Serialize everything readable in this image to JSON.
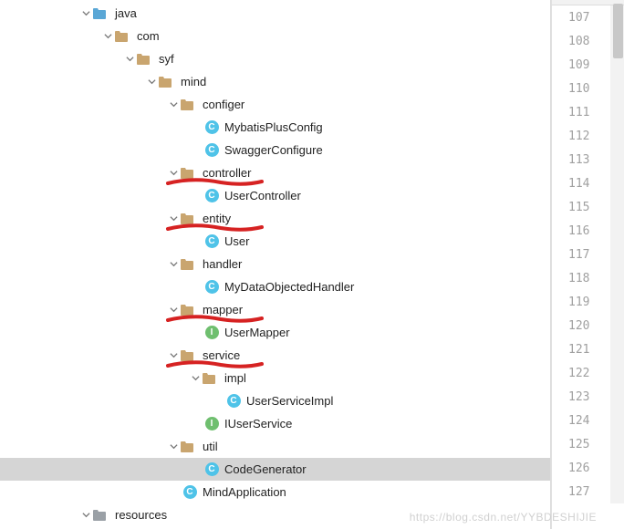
{
  "tree": [
    {
      "indent": 80,
      "chev": "down",
      "icon": "folder-blue",
      "label": "java"
    },
    {
      "indent": 104,
      "chev": "down",
      "icon": "folder-tan",
      "label": "com"
    },
    {
      "indent": 128,
      "chev": "down",
      "icon": "folder-tan",
      "label": "syf"
    },
    {
      "indent": 152,
      "chev": "down",
      "icon": "folder-tan",
      "label": "mind"
    },
    {
      "indent": 176,
      "chev": "down",
      "icon": "folder-tan",
      "label": "configer"
    },
    {
      "indent": 200,
      "chev": "none",
      "icon": "class",
      "label": "MybatisPlusConfig"
    },
    {
      "indent": 200,
      "chev": "none",
      "icon": "class",
      "label": "SwaggerConfigure"
    },
    {
      "indent": 176,
      "chev": "down",
      "icon": "folder-tan",
      "label": "controller",
      "mark": true
    },
    {
      "indent": 200,
      "chev": "none",
      "icon": "class",
      "label": "UserController"
    },
    {
      "indent": 176,
      "chev": "down",
      "icon": "folder-tan",
      "label": "entity",
      "mark": true
    },
    {
      "indent": 200,
      "chev": "none",
      "icon": "class",
      "label": "User"
    },
    {
      "indent": 176,
      "chev": "down",
      "icon": "folder-tan",
      "label": "handler"
    },
    {
      "indent": 200,
      "chev": "none",
      "icon": "class",
      "label": "MyDataObjectedHandler"
    },
    {
      "indent": 176,
      "chev": "down",
      "icon": "folder-tan",
      "label": "mapper",
      "mark": true
    },
    {
      "indent": 200,
      "chev": "none",
      "icon": "interface",
      "label": "UserMapper"
    },
    {
      "indent": 176,
      "chev": "down",
      "icon": "folder-tan",
      "label": "service",
      "mark": true
    },
    {
      "indent": 200,
      "chev": "down",
      "icon": "folder-tan",
      "label": "impl"
    },
    {
      "indent": 224,
      "chev": "none",
      "icon": "class",
      "label": "UserServiceImpl"
    },
    {
      "indent": 200,
      "chev": "none",
      "icon": "interface",
      "label": "IUserService"
    },
    {
      "indent": 176,
      "chev": "down",
      "icon": "folder-tan",
      "label": "util"
    },
    {
      "indent": 200,
      "chev": "none",
      "icon": "class",
      "label": "CodeGenerator",
      "selected": true
    },
    {
      "indent": 176,
      "chev": "none",
      "icon": "class",
      "label": "MindApplication"
    },
    {
      "indent": 80,
      "chev": "down",
      "icon": "folder-gray",
      "label": "resources"
    }
  ],
  "gutter": {
    "start": 107,
    "end": 127
  },
  "watermark": "https://blog.csdn.net/YYBDESHIJIE"
}
